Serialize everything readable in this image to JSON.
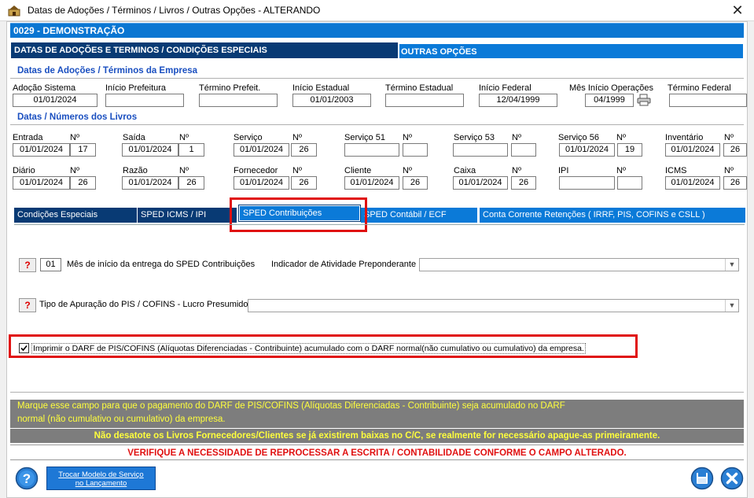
{
  "window": {
    "title": "Datas de Adoções / Términos / Livros / Outras Opções   -   ALTERANDO"
  },
  "company": {
    "label": "0029   -   DEMONSTRAÇÃO"
  },
  "main_tabs": {
    "active": "DATAS DE ADOÇÕES E TERMINOS / CONDIÇÕES ESPECIAIS",
    "other": "OUTRAS OPÇÕES"
  },
  "adocoes": {
    "section_title": "Datas de Adoções / Términos da Empresa",
    "fields": [
      {
        "label": "Adoção Sistema",
        "value": "01/01/2024"
      },
      {
        "label": "Início Prefeitura",
        "value": ""
      },
      {
        "label": "Término Prefeit.",
        "value": ""
      },
      {
        "label": "Início Estadual",
        "value": "01/01/2003"
      },
      {
        "label": "Término Estadual",
        "value": ""
      },
      {
        "label": "Início Federal",
        "value": "12/04/1999"
      },
      {
        "label": "Mês Início Operações",
        "value": "04/1999"
      },
      {
        "label": "Término Federal",
        "value": ""
      }
    ]
  },
  "livros": {
    "section_title": "Datas / Números dos Livros",
    "num_label": "Nº",
    "row1": [
      {
        "label": "Entrada",
        "date": "01/01/2024",
        "num": "17"
      },
      {
        "label": "Saída",
        "date": "01/01/2024",
        "num": "1"
      },
      {
        "label": "Serviço",
        "date": "01/01/2024",
        "num": "26"
      },
      {
        "label": "Serviço 51",
        "date": "",
        "num": ""
      },
      {
        "label": "Serviço 53",
        "date": "",
        "num": ""
      },
      {
        "label": "Serviço 56",
        "date": "01/01/2024",
        "num": "19"
      },
      {
        "label": "Inventário",
        "date": "01/01/2024",
        "num": "26"
      }
    ],
    "row2": [
      {
        "label": "Diário",
        "date": "01/01/2024",
        "num": "26"
      },
      {
        "label": "Razão",
        "date": "01/01/2024",
        "num": "26"
      },
      {
        "label": "Fornecedor",
        "date": "01/01/2024",
        "num": "26"
      },
      {
        "label": "Cliente",
        "date": "01/01/2024",
        "num": "26"
      },
      {
        "label": "Caixa",
        "date": "01/01/2024",
        "num": "26"
      },
      {
        "label": "IPI",
        "date": "",
        "num": ""
      },
      {
        "label": "ICMS",
        "date": "01/01/2024",
        "num": "26"
      }
    ]
  },
  "sub_tabs": [
    "Condições Especiais",
    "SPED ICMS / IPI",
    "SPED Contribuições",
    "SPED Contábil / ECF",
    "Conta Corrente Retenções ( IRRF,  PIS,  COFINS  e  CSLL )"
  ],
  "sped": {
    "help_label": "?",
    "mes_value": "01",
    "mes_label": "Mês de início da entrega do SPED Contribuições",
    "indicador_label": "Indicador de Atividade Preponderante",
    "indicador_value": "",
    "apuracao_label": "Tipo de Apuração do PIS / COFINS - Lucro Presumido:",
    "apuracao_value": "",
    "checkbox_label": "Imprimir o DARF de PIS/COFINS (Alíquotas Diferenciadas - Contribuinte) acumulado com o DARF normal(não cumulativo ou cumulativo) da empresa.",
    "checkbox_checked": true
  },
  "messages": {
    "hint_line1": "Marque  esse  campo  para  que  o  pagamento  do  DARF de PIS/COFINS (Alíquotas Diferenciadas - Contribuinte)  seja  acumulado  no  DARF",
    "hint_line2": "normal (não cumulativo ou cumulativo) da empresa.",
    "warning": "Não desatote os Livros Fornecedores/Clientes se já existirem baixas no C/C, se realmente for necessário apague-as primeiramente.",
    "alert": "VERIFIQUE A NECESSIDADE DE REPROCESSAR A ESCRITA / CONTABILIDADE CONFORME O CAMPO ALTERADO."
  },
  "footer": {
    "trocar_line1": "Trocar Modelo de Serviço",
    "trocar_line2": "no Lançamento"
  },
  "colors": {
    "accent_blue": "#0a76d2",
    "dark_navy": "#083a74",
    "highlight_red": "#e01010",
    "message_yellow": "#ffff3c"
  }
}
